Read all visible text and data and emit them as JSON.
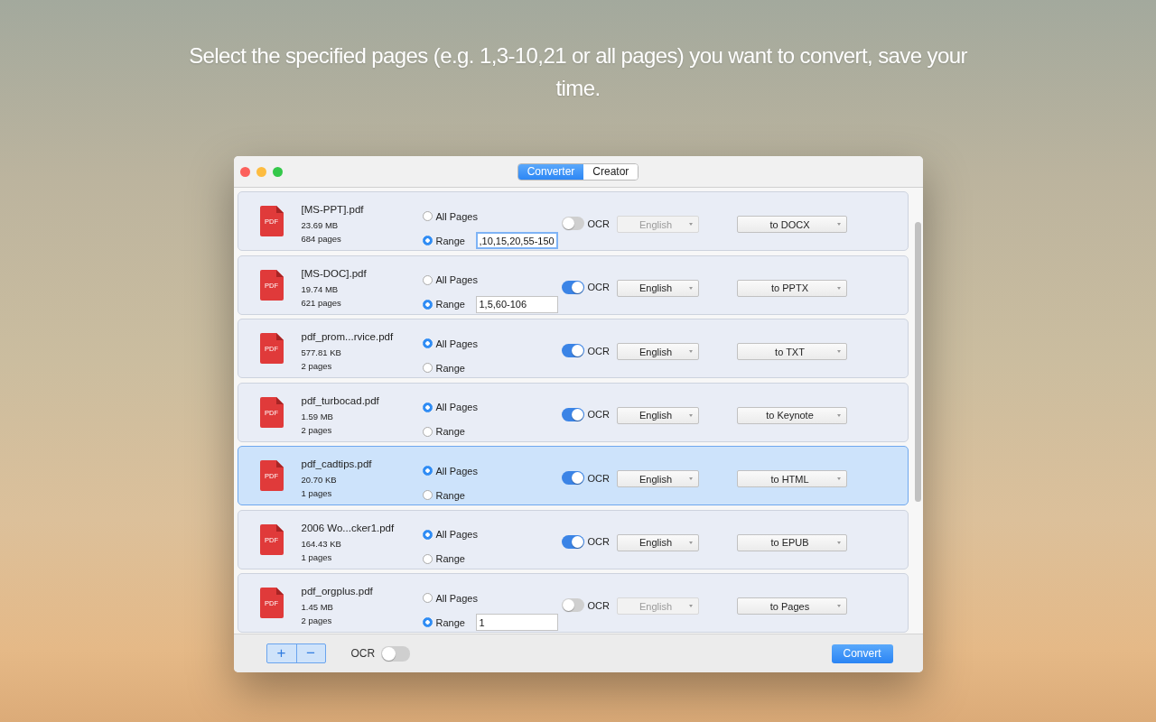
{
  "headline": "Select the specified pages (e.g. 1,3-10,21 or all pages) you want to convert, save your time.",
  "window": {
    "tabs": [
      {
        "label": "Converter",
        "selected": true
      },
      {
        "label": "Creator",
        "selected": false
      }
    ]
  },
  "files": [
    {
      "icon_label": "PDF",
      "name": "[MS-PPT].pdf",
      "size": "23.69 MB",
      "pages": "684 pages",
      "options": [
        {
          "label": "All Pages",
          "selected": false
        },
        {
          "label": "Range",
          "selected": true
        }
      ],
      "range_value": ",10,15,20,55-150",
      "range_focused": true,
      "ocr_on": false,
      "ocr_label": "OCR",
      "language": "English",
      "language_disabled": true,
      "format": "to DOCX",
      "selected": false
    },
    {
      "icon_label": "PDF",
      "name": "[MS-DOC].pdf",
      "size": "19.74 MB",
      "pages": "621 pages",
      "options": [
        {
          "label": "All Pages",
          "selected": false
        },
        {
          "label": "Range",
          "selected": true
        }
      ],
      "range_value": "1,5,60-106",
      "range_focused": false,
      "ocr_on": true,
      "ocr_label": "OCR",
      "language": "English",
      "language_disabled": false,
      "format": "to PPTX",
      "selected": false
    },
    {
      "icon_label": "PDF",
      "name": "pdf_prom...rvice.pdf",
      "size": "577.81 KB",
      "pages": "2 pages",
      "options": [
        {
          "label": "All Pages",
          "selected": true
        },
        {
          "label": "Range",
          "selected": false
        }
      ],
      "ocr_on": true,
      "ocr_label": "OCR",
      "language": "English",
      "language_disabled": false,
      "format": "to TXT",
      "selected": false
    },
    {
      "icon_label": "PDF",
      "name": "pdf_turbocad.pdf",
      "size": "1.59 MB",
      "pages": "2 pages",
      "options": [
        {
          "label": "All Pages",
          "selected": true
        },
        {
          "label": "Range",
          "selected": false
        }
      ],
      "ocr_on": true,
      "ocr_label": "OCR",
      "language": "English",
      "language_disabled": false,
      "format": "to Keynote",
      "selected": false
    },
    {
      "icon_label": "PDF",
      "name": "pdf_cadtips.pdf",
      "size": "20.70 KB",
      "pages": "1 pages",
      "options": [
        {
          "label": "All Pages",
          "selected": true
        },
        {
          "label": "Range",
          "selected": false
        }
      ],
      "ocr_on": true,
      "ocr_label": "OCR",
      "language": "English",
      "language_disabled": false,
      "format": "to HTML",
      "selected": true
    },
    {
      "icon_label": "PDF",
      "name": "2006 Wo...cker1.pdf",
      "size": "164.43 KB",
      "pages": "1 pages",
      "options": [
        {
          "label": "All Pages",
          "selected": true
        },
        {
          "label": "Range",
          "selected": false
        }
      ],
      "ocr_on": true,
      "ocr_label": "OCR",
      "language": "English",
      "language_disabled": false,
      "format": "to EPUB",
      "selected": false
    },
    {
      "icon_label": "PDF",
      "name": "pdf_orgplus.pdf",
      "size": "1.45 MB",
      "pages": "2 pages",
      "options": [
        {
          "label": "All Pages",
          "selected": false
        },
        {
          "label": "Range",
          "selected": true
        }
      ],
      "range_value": "1",
      "range_focused": false,
      "ocr_on": false,
      "ocr_label": "OCR",
      "language": "English",
      "language_disabled": true,
      "format": "to Pages",
      "selected": false
    }
  ],
  "bottom_bar": {
    "add_label": "+",
    "remove_label": "−",
    "ocr_label": "OCR",
    "ocr_on": false,
    "convert_label": "Convert"
  }
}
